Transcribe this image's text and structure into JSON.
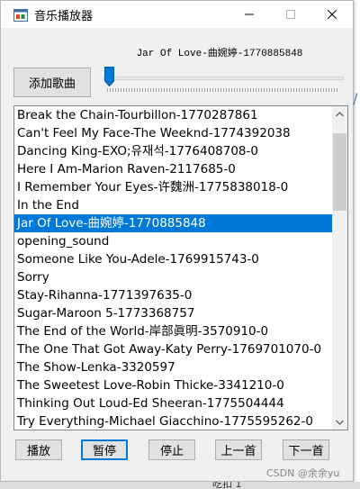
{
  "window": {
    "title": "音乐播放器",
    "icon": "music-player-app-icon",
    "controls": [
      "minimize",
      "maximize",
      "close"
    ]
  },
  "player": {
    "now_playing": "Jar Of Love-曲婉婷-1770885848",
    "add_button_label": "添加歌曲",
    "progress": 0.0
  },
  "playlist": {
    "selected_index": 6,
    "items": [
      "Break the Chain-Tourbillon-1770287861",
      "Can't Feel My Face-The Weeknd-1774392038",
      "Dancing King-EXO;유재석-1776408708-0",
      "Here I Am-Marion Raven-2117685-0",
      "I Remember Your Eyes-许魏洲-1775838018-0",
      "In the End",
      "Jar Of Love-曲婉婷-1770885848",
      "opening_sound",
      "Someone Like You-Adele-1769915743-0",
      "Sorry",
      "Stay-Rihanna-1771397635-0",
      "Sugar-Maroon 5-1773368757",
      "The End of the World-岸部眞明-3570910-0",
      "The One That Got Away-Katy Perry-1769701070-0",
      "The Show-Lenka-3320597",
      "The Sweetest Love-Robin Thicke-3341210-0",
      "Thinking Out Loud-Ed Sheeran-1775504444",
      "Try Everything-Michael Giacchino-1775595262-0"
    ]
  },
  "controls": {
    "play": "播放",
    "pause": "暂停",
    "stop": "停止",
    "previous": "上一首",
    "next": "下一首"
  },
  "watermark": "CSDN @余余yu",
  "taskbar_fragment": "吃扣 1",
  "colors": {
    "selection": "#0078d7",
    "window_bg": "#f0f0f0",
    "accent": "#0078d7"
  }
}
